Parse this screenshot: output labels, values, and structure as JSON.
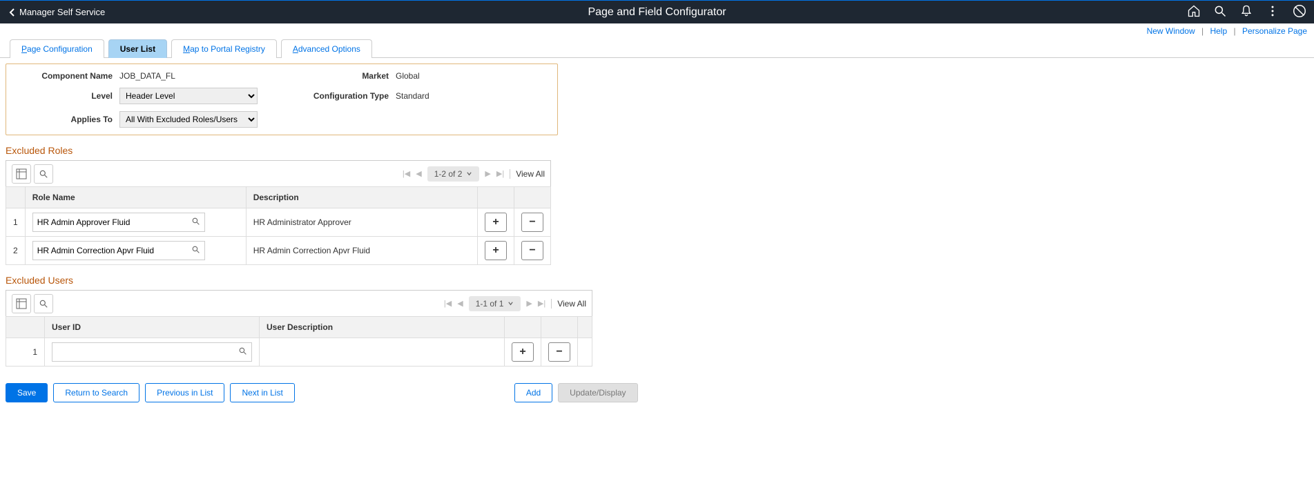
{
  "header": {
    "back_label": "Manager Self Service",
    "title": "Page and Field Configurator"
  },
  "top_links": {
    "new_window": "New Window",
    "help": "Help",
    "personalize": "Personalize Page"
  },
  "tabs": {
    "page_config": "age Configuration",
    "user_list": "User List",
    "map_portal": "ap to Portal Registry",
    "adv_options": "dvanced Options"
  },
  "component": {
    "name_label": "Component Name",
    "name_value": "JOB_DATA_FL",
    "level_label": "Level",
    "level_value": "Header Level",
    "applies_label": "Applies To",
    "applies_value": "All With Excluded Roles/Users",
    "market_label": "Market",
    "market_value": "Global",
    "config_type_label": "Configuration Type",
    "config_type_value": "Standard"
  },
  "excluded_roles": {
    "heading": "Excluded Roles",
    "page_info": "1-2 of 2",
    "view_all": "View All",
    "col_role": "Role Name",
    "col_desc": "Description",
    "rows": [
      {
        "num": "1",
        "role": "HR Admin Approver Fluid",
        "desc": "HR Administrator Approver"
      },
      {
        "num": "2",
        "role": "HR Admin Correction Apvr Fluid",
        "desc": "HR Admin Correction Apvr Fluid"
      }
    ]
  },
  "excluded_users": {
    "heading": "Excluded Users",
    "page_info": "1-1 of 1",
    "view_all": "View All",
    "col_user": "User ID",
    "col_desc": "User Description",
    "rows": [
      {
        "num": "1",
        "user": "",
        "desc": ""
      }
    ]
  },
  "footer": {
    "save": "Save",
    "return": "Return to Search",
    "prev": "Previous in List",
    "next": "Next in List",
    "add": "Add",
    "update": "Update/Display"
  }
}
